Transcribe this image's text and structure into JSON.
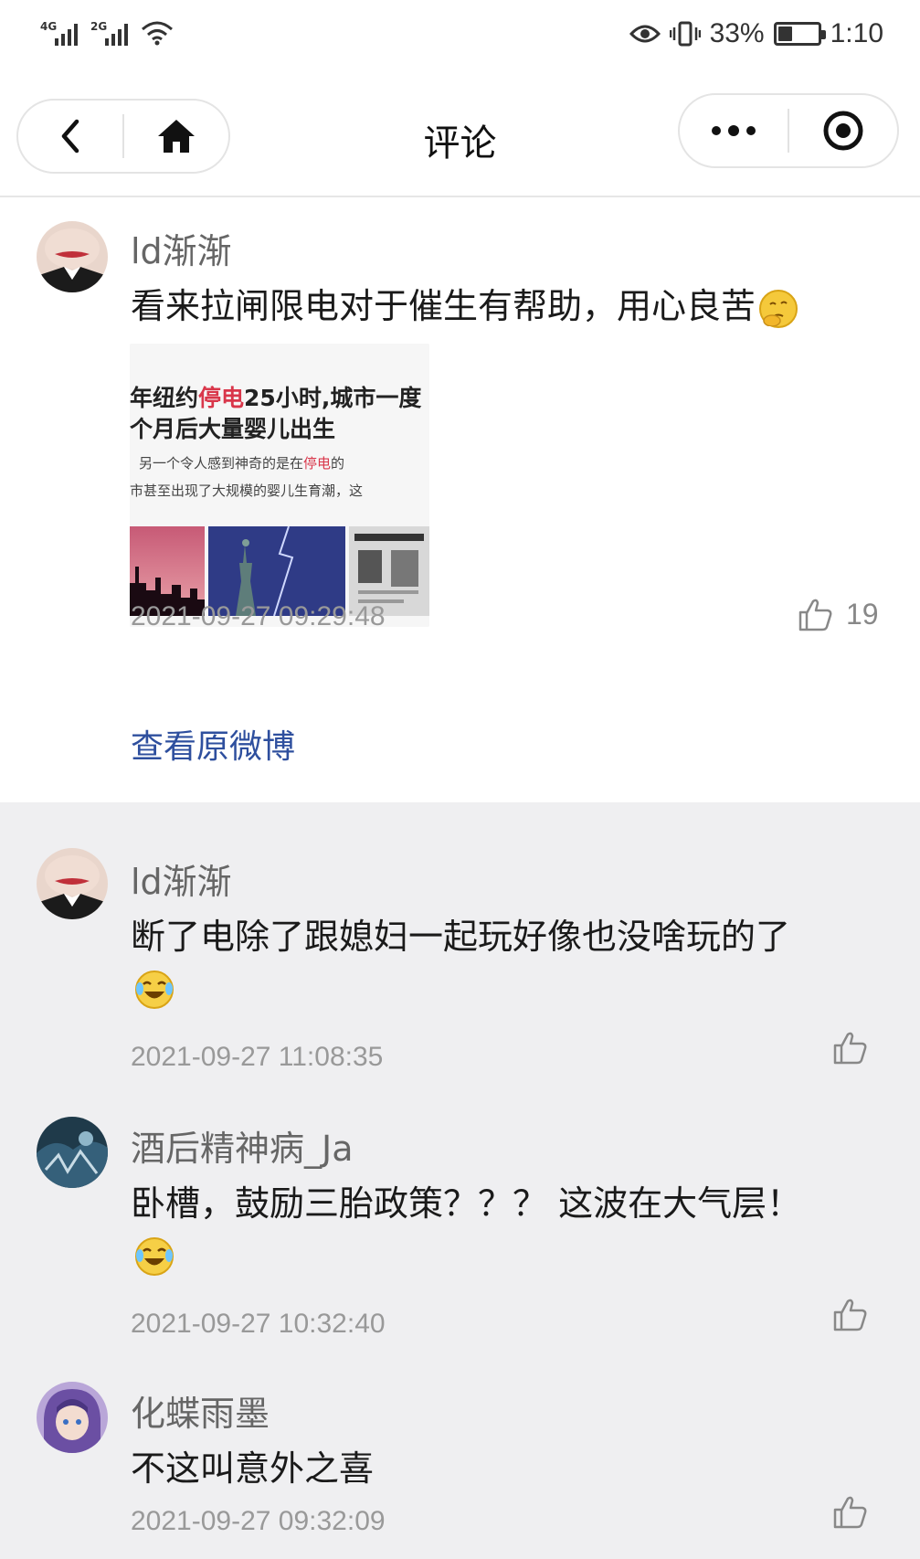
{
  "status_bar": {
    "signal1_tag": "4G",
    "signal2_tag": "2G",
    "battery_text": "33%",
    "battery_level": 0.33,
    "time": "1:10"
  },
  "nav": {
    "title": "评论",
    "back_icon": "chevron-left-icon",
    "home_icon": "home-icon",
    "more_icon": "more-dots-icon",
    "close_icon": "target-circle-icon"
  },
  "main_comment": {
    "username": "ld渐渐",
    "text": "看来拉闸限电对于催生有帮助，用心良苦",
    "emoji": "thinking-emoji",
    "image": {
      "line1_prefix": "年纽约",
      "line1_red": "停电",
      "line1_suffix": "25小时,城市一度",
      "line2": "个月后大量婴儿出生",
      "line3_prefix": "另一个令人感到神奇的是在",
      "line3_red": "停电",
      "line3_suffix": "的",
      "line4": "市甚至出现了大规模的婴儿生育潮，这"
    },
    "timestamp": "2021-09-27 09:29:48",
    "likes": "19",
    "view_original": "查看原微博"
  },
  "replies": [
    {
      "username": "ld渐渐",
      "text": "断了电除了跟媳妇一起玩好像也没啥玩的了",
      "emoji": "laugh-cry-emoji",
      "timestamp": "2021-09-27 11:08:35"
    },
    {
      "username": "酒后精神病_Ja",
      "text": "卧槽，鼓励三胎政策？？？ 这波在大气层！",
      "emoji": "laugh-cry-emoji",
      "timestamp": "2021-09-27 10:32:40"
    },
    {
      "username": "化蝶雨墨",
      "text": "不这叫意外之喜",
      "timestamp": "2021-09-27 09:32:09"
    }
  ],
  "colors": {
    "link": "#2e4f9e",
    "page_bg": "#efeff1",
    "red_highlight": "#d9364a"
  }
}
